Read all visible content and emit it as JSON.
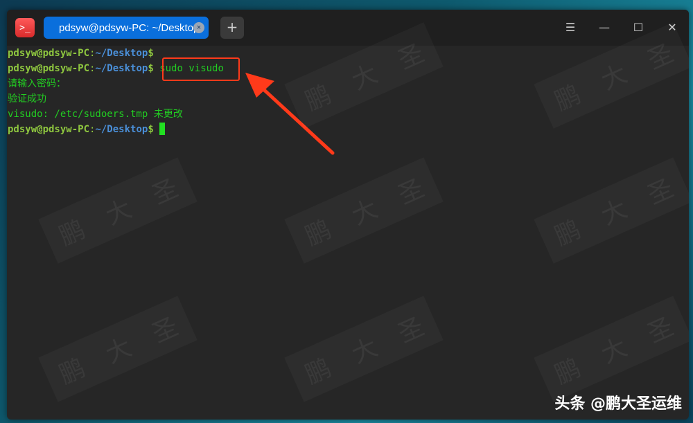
{
  "titlebar": {
    "app_icon": ">_",
    "tab_label": "pdsyw@pdsyw-PC: ~/Desktop",
    "tab_close": "×",
    "new_tab": "+",
    "menu": "☰",
    "minimize": "—",
    "maximize": "☐",
    "close": "✕"
  },
  "terminal": {
    "prompt_user": "pdsyw@pdsyw-PC",
    "prompt_colon": ":",
    "prompt_path": "~/Desktop",
    "prompt_dollar": "$",
    "command": "sudo visudo",
    "output_password": "请输入密码：",
    "output_success": "验证成功",
    "output_unchanged": "visudo: /etc/sudoers.tmp 未更改"
  },
  "watermark": [
    "鹏",
    "大",
    "圣"
  ],
  "brand": "头条 @鹏大圣运维",
  "colors": {
    "prompt_user": "#8ec63f",
    "prompt_path": "#4a8fd8",
    "output": "#22cc22",
    "annotation": "#ff3a1a",
    "tab": "#0a6fdc"
  }
}
